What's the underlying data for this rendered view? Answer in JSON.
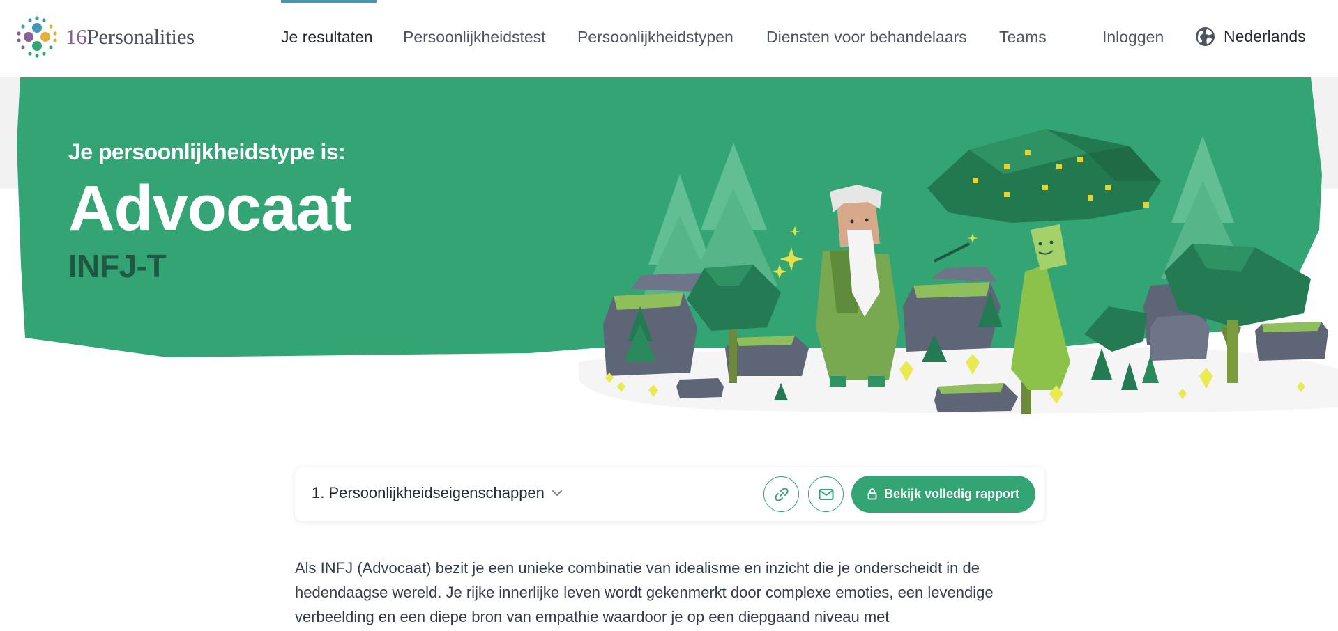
{
  "brand": {
    "number": "16",
    "name": "Personalities"
  },
  "nav": {
    "items": [
      {
        "label": "Je resultaten",
        "active": true
      },
      {
        "label": "Persoonlijkheidstest",
        "active": false
      },
      {
        "label": "Persoonlijkheidstypen",
        "active": false
      },
      {
        "label": "Diensten voor behandelaars",
        "active": false
      },
      {
        "label": "Teams",
        "active": false
      }
    ],
    "login": "Inloggen",
    "language": "Nederlands",
    "language_icon": "globe-icon"
  },
  "hero": {
    "kicker": "Je persoonlijkheidstype is:",
    "type_name": "Advocaat",
    "type_code": "INFJ-T"
  },
  "section_bar": {
    "selected_section": "1. Persoonlijkheidseigenschappen",
    "link_icon": "link-icon",
    "mail_icon": "mail-icon",
    "report_button": "Bekijk volledig rapport",
    "report_icon": "lock-icon"
  },
  "intro": {
    "text": "Als INFJ (Advocaat) bezit je een unieke combinatie van idealisme en inzicht die je onderscheidt in de hedendaagse wereld. Je rijke innerlijke leven wordt gekenmerkt door complexe emoties, een levendige verbeelding en een diepe bron van empathie waardoor je op een diepgaand niveau met"
  },
  "colors": {
    "brand_green": "#33a474",
    "dark_green": "#1f5742",
    "active_bar": "#4298b4",
    "text_dark": "#262b33"
  }
}
